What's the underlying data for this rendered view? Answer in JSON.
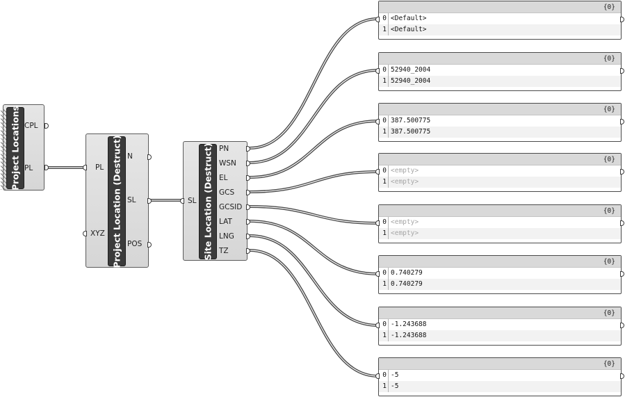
{
  "components": {
    "project_locations": {
      "name": "Project Locations",
      "outputs": [
        "CPL",
        "PL"
      ]
    },
    "project_location_destruct": {
      "name": "Project Location (Destruct)",
      "inputs": [
        "PL",
        "XYZ"
      ],
      "outputs": [
        "N",
        "SL",
        "POS"
      ]
    },
    "site_location_destruct": {
      "name": "Site Location (Destruct)",
      "inputs": [
        "SL"
      ],
      "outputs": [
        "PN",
        "WSN",
        "EL",
        "GCS",
        "GCSID",
        "LAT",
        "LNG",
        "TZ"
      ]
    }
  },
  "panels": [
    {
      "header": "{0}",
      "rows": [
        {
          "index": "0",
          "value": "<Default>"
        },
        {
          "index": "1",
          "value": "<Default>"
        }
      ]
    },
    {
      "header": "{0}",
      "rows": [
        {
          "index": "0",
          "value": "52940_2004"
        },
        {
          "index": "1",
          "value": "52940_2004"
        }
      ]
    },
    {
      "header": "{0}",
      "rows": [
        {
          "index": "0",
          "value": "387.500775"
        },
        {
          "index": "1",
          "value": "387.500775"
        }
      ]
    },
    {
      "header": "{0}",
      "rows": [
        {
          "index": "0",
          "value": "<empty>"
        },
        {
          "index": "1",
          "value": "<empty>"
        }
      ]
    },
    {
      "header": "{0}",
      "rows": [
        {
          "index": "0",
          "value": "<empty>"
        },
        {
          "index": "1",
          "value": "<empty>"
        }
      ]
    },
    {
      "header": "{0}",
      "rows": [
        {
          "index": "0",
          "value": "0.740279"
        },
        {
          "index": "1",
          "value": "0.740279"
        }
      ]
    },
    {
      "header": "{0}",
      "rows": [
        {
          "index": "0",
          "value": "-1.243688"
        },
        {
          "index": "1",
          "value": "-1.243688"
        }
      ]
    },
    {
      "header": "{0}",
      "rows": [
        {
          "index": "0",
          "value": "-5"
        },
        {
          "index": "1",
          "value": "-5"
        }
      ]
    }
  ],
  "colors": {
    "canvas": "#ffffff",
    "component_fill": "#dcdcdc",
    "name_bar": "#3b3b3b",
    "wire": "#4a4a4a",
    "empty_text": "#a6a6a6"
  }
}
